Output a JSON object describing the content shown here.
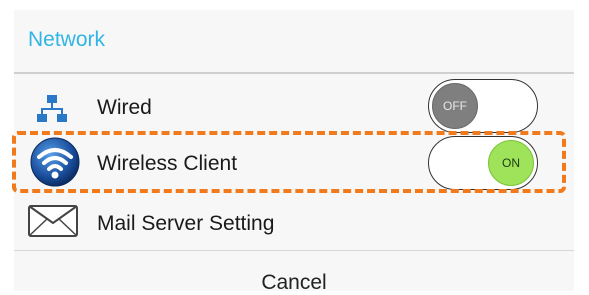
{
  "dialog": {
    "title": "Network",
    "items": [
      {
        "label": "Wired",
        "toggle": "OFF",
        "icon": "network-icon"
      },
      {
        "label": "Wireless Client",
        "toggle": "ON",
        "icon": "wifi-icon"
      },
      {
        "label": "Mail Server Setting",
        "icon": "mail-icon"
      }
    ],
    "cancel_label": "Cancel"
  },
  "colors": {
    "title": "#32b5e5",
    "highlight": "#f07a1c",
    "toggle_on": "#9ee35a",
    "toggle_off": "#7f7f7f"
  }
}
